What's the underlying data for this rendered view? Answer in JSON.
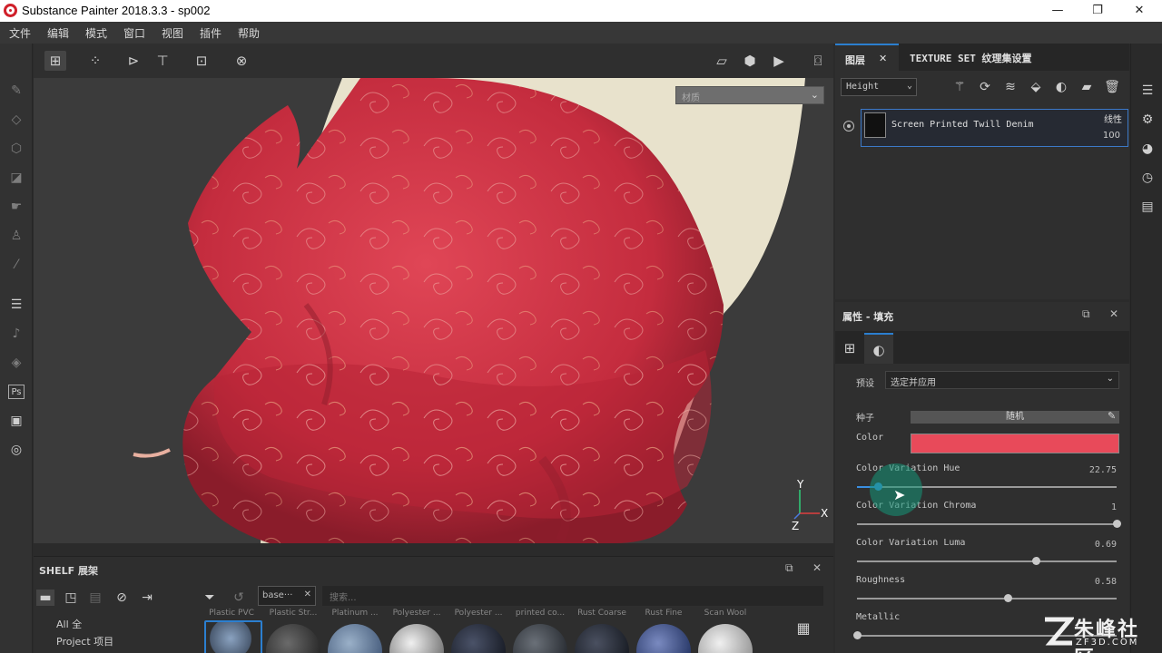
{
  "window": {
    "title": "Substance Painter 2018.3.3 - sp002",
    "minimize": "—",
    "maximize": "❐",
    "close": "✕"
  },
  "menu": [
    "文件",
    "编辑",
    "模式",
    "窗口",
    "视图",
    "插件",
    "帮助"
  ],
  "viewport": {
    "material_select": "材质",
    "axis": {
      "y": "Y",
      "x": "X",
      "z": "Z"
    }
  },
  "layers_panel": {
    "tab_layers": "图层",
    "tab_texture_set": "TEXTURE SET 纹理集设置",
    "channel": "Height",
    "layer": {
      "name": "Screen Printed Twill Denim",
      "blend": "线性",
      "opacity": "100"
    }
  },
  "properties_panel": {
    "title": "属性 - 填充",
    "preset_label": "预设",
    "preset_value": "选定并应用",
    "seed_label": "种子",
    "seed_value": "随机",
    "color_label": "Color",
    "color_value": "#e84a5a",
    "sliders": [
      {
        "label": "Color Variation Hue",
        "value": "22.75",
        "fraction": 0.08
      },
      {
        "label": "Color Variation Chroma",
        "value": "1",
        "fraction": 1.0
      },
      {
        "label": "Color Variation Luma",
        "value": "0.69",
        "fraction": 0.69
      },
      {
        "label": "Roughness",
        "value": "0.58",
        "fraction": 0.58
      },
      {
        "label": "Metallic",
        "value": "",
        "fraction": 0.0
      }
    ]
  },
  "shelf": {
    "title": "SHELF 展架",
    "filter_tag": "base···",
    "search_placeholder": "搜索...",
    "categories": [
      "All 全",
      "Project 项目"
    ],
    "thumbnails": [
      {
        "label": "Plastic PVC",
        "color": "#6f8aa8"
      },
      {
        "label": "Plastic Str...",
        "color": "#3a3a3a"
      },
      {
        "label": "Platinum ...",
        "color": "#6f89a6"
      },
      {
        "label": "Polyester ...",
        "color": "#b8b8b8"
      },
      {
        "label": "Polyester ...",
        "color": "#252a38"
      },
      {
        "label": "printed co...",
        "color": "#3a3e44"
      },
      {
        "label": "Rust Coarse",
        "color": "#2a2e36"
      },
      {
        "label": "Rust Fine",
        "color": "#3a4a7a"
      },
      {
        "label": "Scan Wool",
        "color": "#cccccc"
      }
    ]
  },
  "watermark": {
    "brand": "朱峰社区",
    "site": "ZF3D.COM"
  },
  "colors": {
    "accent": "#2b7fd0",
    "fabric": "#d23848",
    "background": "#3b3b3b"
  }
}
